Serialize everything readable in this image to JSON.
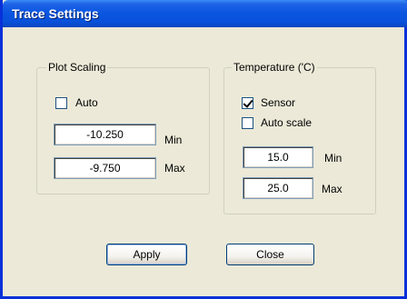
{
  "window": {
    "title": "Trace Settings"
  },
  "plot_scaling": {
    "label": "Plot Scaling",
    "auto_label": "Auto",
    "auto_checked": false,
    "min_value": "-10.250",
    "min_label": "Min",
    "max_value": "-9.750",
    "max_label": "Max"
  },
  "temperature": {
    "label": "Temperature ('C)",
    "sensor_label": "Sensor",
    "sensor_checked": true,
    "auto_scale_label": "Auto scale",
    "auto_scale_checked": false,
    "min_value": "15.0",
    "min_label": "Min",
    "max_value": "25.0",
    "max_label": "Max"
  },
  "buttons": {
    "apply": "Apply",
    "close": "Close"
  }
}
